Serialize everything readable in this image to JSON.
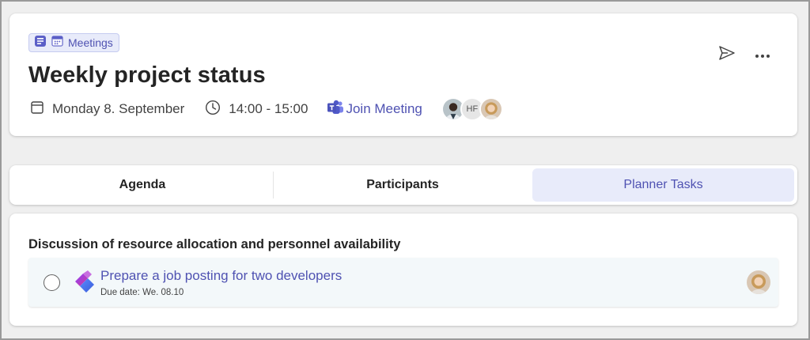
{
  "header": {
    "category_label": "Meetings",
    "title": "Weekly project status",
    "date": "Monday 8. September",
    "time": "14:00 - 15:00",
    "join_label": "Join Meeting",
    "participants": [
      {
        "type": "photo",
        "name": "participant-1"
      },
      {
        "type": "initials",
        "initials": "HF"
      },
      {
        "type": "photo",
        "name": "participant-3"
      }
    ],
    "actions": [
      "send-icon",
      "more-icon"
    ]
  },
  "tabs": [
    {
      "label": "Agenda",
      "active": false
    },
    {
      "label": "Participants",
      "active": false
    },
    {
      "label": "Planner Tasks",
      "active": true
    }
  ],
  "content": {
    "section_title": "Discussion of resource allocation and personnel availability",
    "tasks": [
      {
        "title": "Prepare a job posting for two developers",
        "due": "Due date: We. 08.10",
        "completed": false,
        "icon": "planner-logo-icon"
      }
    ]
  },
  "colors": {
    "accent": "#4f52b2",
    "tab_active_bg": "#e8ebfa",
    "task_row_bg": "#f3f8fa"
  }
}
